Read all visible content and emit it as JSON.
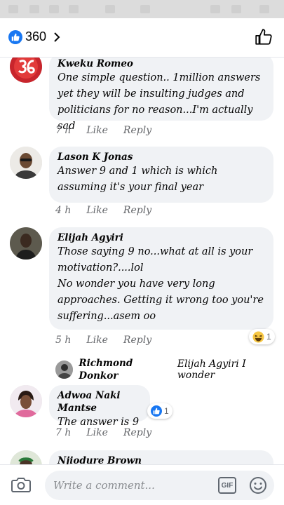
{
  "header": {
    "reaction_count": "360"
  },
  "comments": [
    {
      "author": "Kweku Romeo",
      "text": "One simple question.. 1million answers yet they will be insulting judges and politicians for no reason...I'm actually sad",
      "time": "7 h",
      "like": "Like",
      "reply": "Reply"
    },
    {
      "author": "Lason K Jonas",
      "text": "Answer 9 and 1 which is which assuming it's your final year",
      "time": "4 h",
      "like": "Like",
      "reply": "Reply"
    },
    {
      "author": "Elijah Agyiri",
      "text": "Those saying 9 no...what at all is your motivation?....lol\nNo wonder you have very long approaches. Getting it wrong too you're suffering...asem oo",
      "time": "5 h",
      "like": "Like",
      "reply": "Reply",
      "reaction_count": "1"
    },
    {
      "author": "Adwoa Naki Mantse",
      "text": "The answer is 9",
      "time": "7 h",
      "like": "Like",
      "reply": "Reply",
      "reaction_count": "1"
    },
    {
      "author": "Njiodure Brown"
    }
  ],
  "reply_preview": {
    "author": "Richmond Donkor",
    "text": "Elijah Agyiri I wonder"
  },
  "composer": {
    "placeholder": "Write a comment...",
    "gif_label": "GIF"
  },
  "colors": {
    "accent": "#1877f2",
    "bubble": "#f0f2f5",
    "meta": "#65676b"
  }
}
